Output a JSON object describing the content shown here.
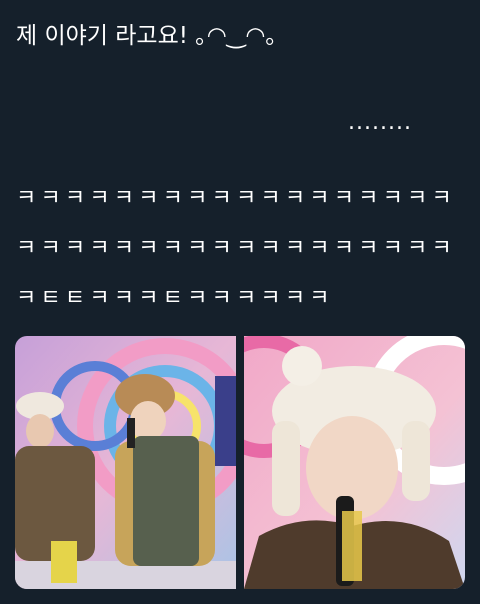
{
  "tweet": {
    "line1": "제 이야기 라고요! ｡◠‿◠｡",
    "dots": "........",
    "laugh_lines": [
      "ㅋㅋㅋㅋㅋㅋㅋㅋㅋㅋㅋㅋㅋㅋㅋㅋㅋㅋ",
      "ㅋㅋㅋㅋㅋㅋㅋㅋㅋㅋㅋㅋㅋㅋㅋㅋㅋㅋ",
      "ㅋㅌㅌㅋㅋㅋㅌㅋㅋㅋㅋㅋㅋ"
    ]
  },
  "media": {
    "photos": [
      {
        "description": "two performers on a colorful TV studio set wearing trapper hats"
      },
      {
        "description": "close-up of performer in white fluffy hat holding microphone"
      }
    ]
  }
}
